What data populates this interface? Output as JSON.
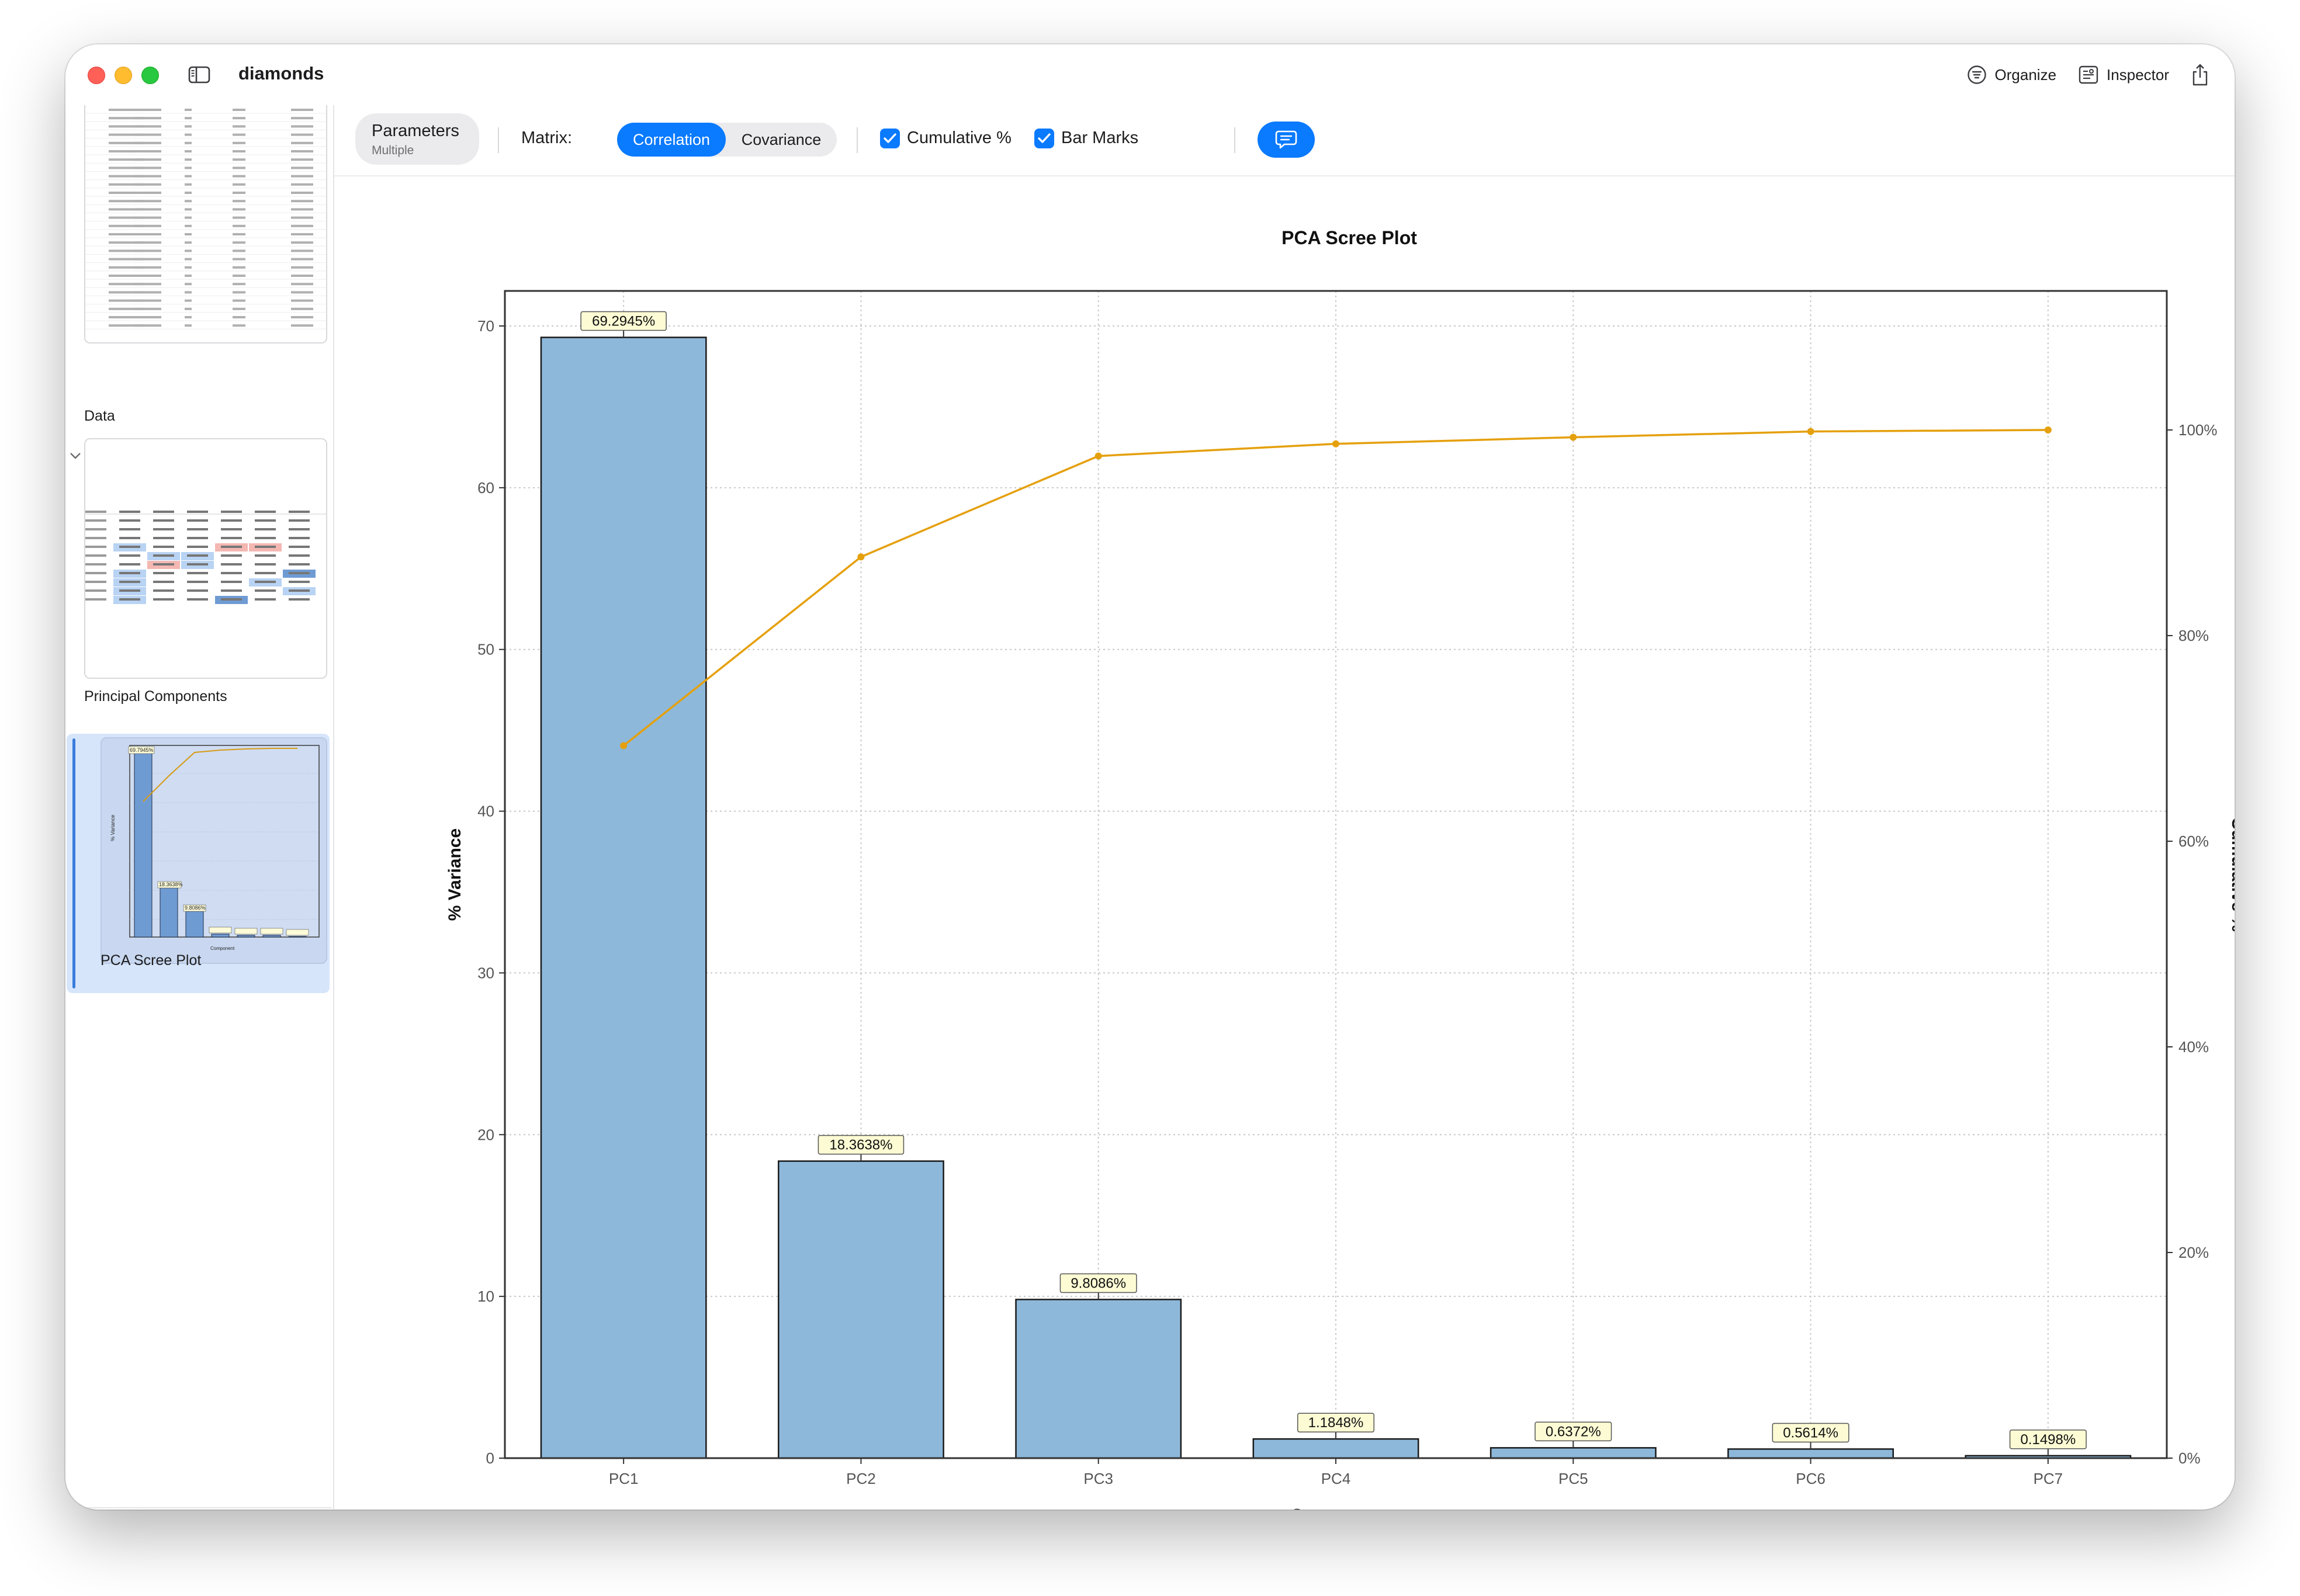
{
  "window": {
    "title": "diamonds"
  },
  "toolbar_right": {
    "organize": "Organize",
    "inspector": "Inspector"
  },
  "sidebar": {
    "items": [
      {
        "label": "Data"
      },
      {
        "label": "Principal Components"
      },
      {
        "label": "PCA Scree Plot"
      }
    ],
    "add_label": "+"
  },
  "toolbar": {
    "parameters_title": "Parameters",
    "parameters_subtitle": "Multiple",
    "matrix_label": "Matrix:",
    "matrix_options": [
      "Correlation",
      "Covariance"
    ],
    "matrix_selected": "Correlation",
    "cumulative_label": "Cumulative %",
    "cumulative_checked": true,
    "bar_marks_label": "Bar Marks",
    "bar_marks_checked": true
  },
  "colors": {
    "accent": "#0a7aff",
    "bar_fill": "#8db8da",
    "line": "#e5a00d",
    "label_bg": "#fcfbd4"
  },
  "chart_data": {
    "type": "bar",
    "title": "PCA Scree Plot",
    "xlabel": "Component",
    "ylabel": "% Variance",
    "y2label": "Cumulative %",
    "categories": [
      "PC1",
      "PC2",
      "PC3",
      "PC4",
      "PC5",
      "PC6",
      "PC7"
    ],
    "values": [
      69.2945,
      18.3638,
      9.8086,
      1.1848,
      0.6372,
      0.5614,
      0.1498
    ],
    "value_labels": [
      "69.2945%",
      "18.3638%",
      "9.8086%",
      "1.1848%",
      "0.6372%",
      "0.5614%",
      "0.1498%"
    ],
    "cumulative": [
      69.2945,
      87.6583,
      97.4669,
      98.6517,
      99.2889,
      99.8503,
      100.0
    ],
    "ylim": [
      0,
      72
    ],
    "y2lim": [
      0,
      105
    ],
    "yticks": [
      0,
      10,
      20,
      30,
      40,
      50,
      60,
      70
    ],
    "y2ticks": [
      0,
      20,
      40,
      60,
      80,
      100
    ],
    "y2ticklabels": [
      "0%",
      "20%",
      "40%",
      "60%",
      "80%",
      "100%"
    ],
    "grid": true
  }
}
